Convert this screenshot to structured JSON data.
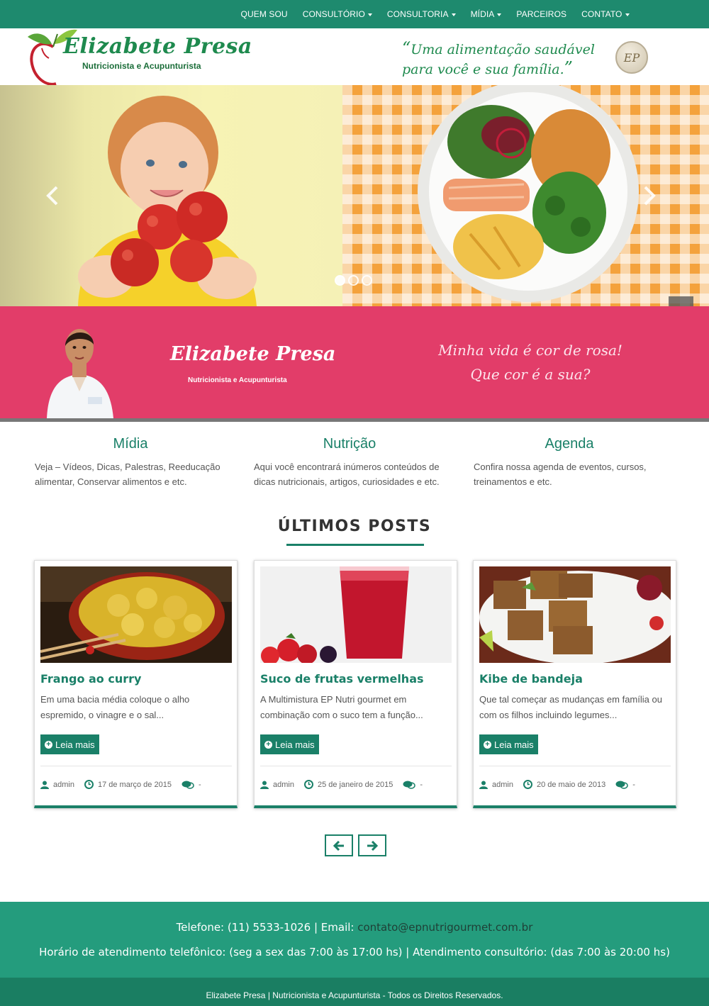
{
  "nav": {
    "items": [
      {
        "label": "QUEM SOU",
        "dropdown": false
      },
      {
        "label": "CONSULTÓRIO",
        "dropdown": true
      },
      {
        "label": "CONSULTORIA",
        "dropdown": true
      },
      {
        "label": "MÍDIA",
        "dropdown": true
      },
      {
        "label": "PARCEIROS",
        "dropdown": false
      },
      {
        "label": "CONTATO",
        "dropdown": true
      }
    ]
  },
  "header": {
    "logo_title": "Elizabete Presa",
    "logo_subtitle": "Nutricionista e Acupunturista",
    "slogan_line1": "Uma alimentação saudável",
    "slogan_line2": "para você e sua família.",
    "seal_text": "EP"
  },
  "slider": {
    "slide_count": 3,
    "active_index": 0
  },
  "banner": {
    "name": "Elizabete Presa",
    "subtitle": "Nutricionista e Acupunturista",
    "quote_line1": "Minha vida é cor de rosa!",
    "quote_line2": "Que cor é a sua?"
  },
  "features": [
    {
      "title": "Mídia",
      "text": "Veja – Vídeos, Dicas, Palestras, Reeducação alimentar, Conservar alimentos e etc."
    },
    {
      "title": "Nutrição",
      "text": "Aqui você encontrará inúmeros conteúdos de dicas nutricionais, artigos, curiosidades e etc."
    },
    {
      "title": "Agenda",
      "text": "Confira nossa agenda de eventos, cursos, treinamentos e etc."
    }
  ],
  "posts": {
    "heading": "ÚLTIMOS POSTS",
    "read_more_label": "Leia mais",
    "items": [
      {
        "title": "Frango ao curry",
        "excerpt": "Em uma bacia média coloque o alho espremido, o vinagre e o sal...",
        "author": "admin",
        "date": "17 de março de 2015",
        "comments": "-"
      },
      {
        "title": "Suco de frutas vermelhas",
        "excerpt": "A Multimistura EP Nutri gourmet em combinação com o suco tem a função...",
        "author": "admin",
        "date": "25 de janeiro de 2015",
        "comments": "-"
      },
      {
        "title": "Kibe de bandeja",
        "excerpt": "Que tal começar as mudanças em família ou com os filhos incluindo legumes...",
        "author": "admin",
        "date": "20 de maio de 2013",
        "comments": "-"
      }
    ]
  },
  "footer": {
    "phone_text": "Telefone: (11) 5533-1026 | Email: ",
    "email": "contato@epnutrigourmet.com.br",
    "hours": "Horário de atendimento telefônico: (seg a sex das 7:00 às 17:00 hs) | Atendimento consultório: (das 7:00 às 20:00 hs)",
    "copyright": "Elizabete Presa | Nutricionista e Acupunturista - Todos os Direitos Reservados."
  },
  "colors": {
    "brand_green": "#1a8068",
    "nav_green": "#1e8a6e",
    "banner_pink": "#e23d69"
  }
}
